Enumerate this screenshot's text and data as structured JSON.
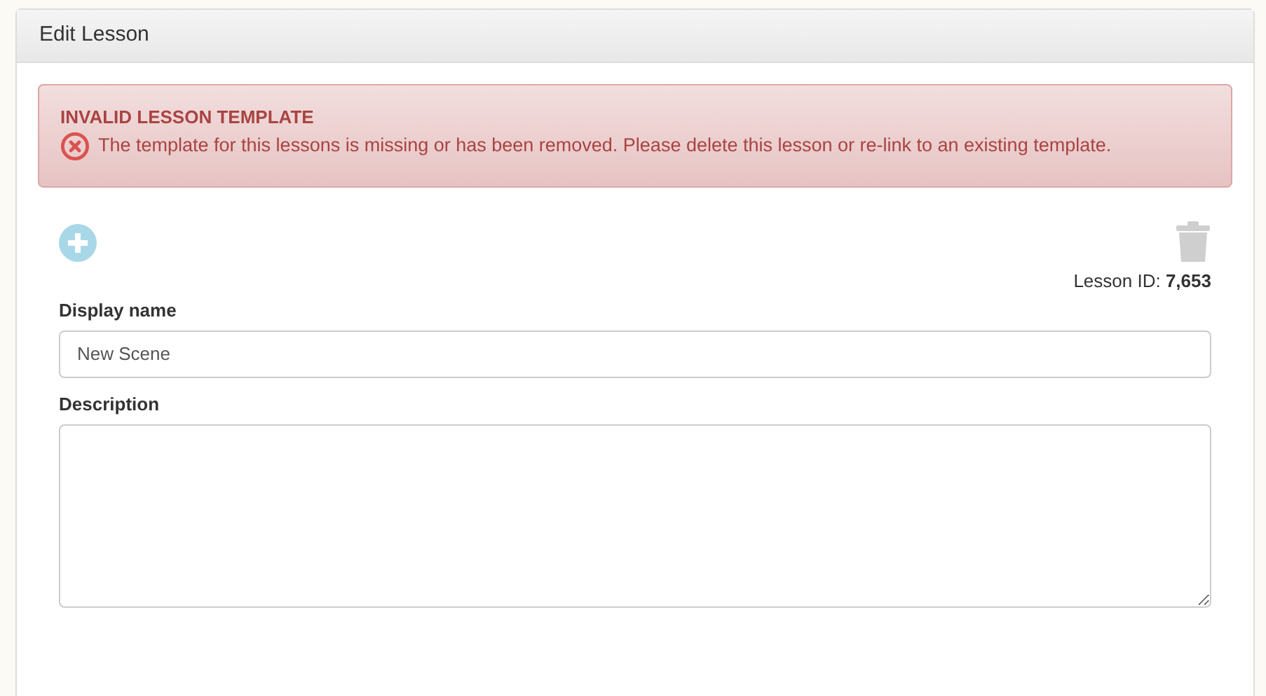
{
  "panel": {
    "title": "Edit Lesson"
  },
  "alert": {
    "title": "INVALID LESSON TEMPLATE",
    "message": "The template for this lessons is missing or has been removed. Please delete this lesson or re-link to an existing template."
  },
  "lesson_id": "Lesson ID: **7,653**",
  "fields": [
    {
      "kind": "input",
      "label": "Display name",
      "value": "New Scene"
    },
    {
      "kind": "textarea",
      "label": "Description"
    }
  ]
}
